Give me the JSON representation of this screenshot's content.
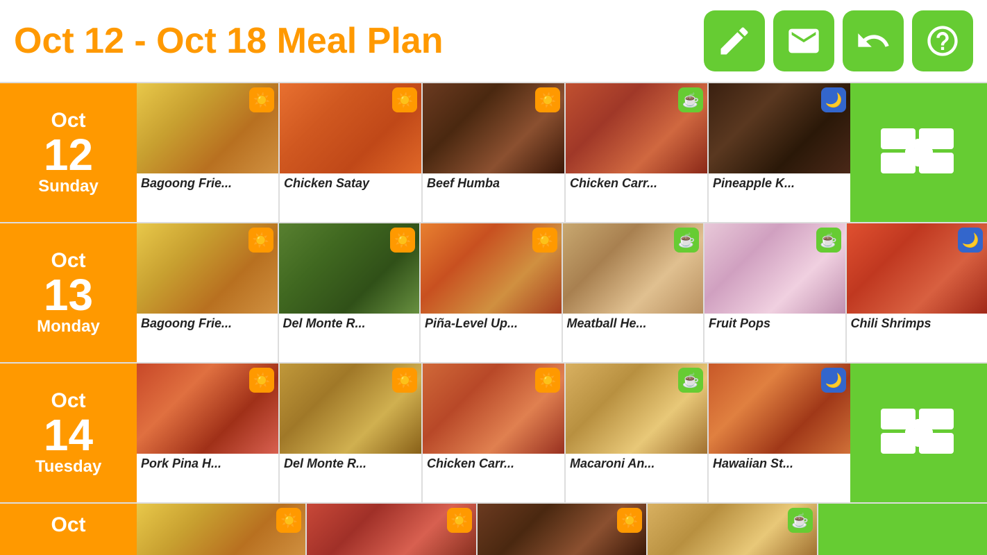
{
  "header": {
    "title": "Oct 12 - Oct 18 Meal Plan",
    "buttons": [
      {
        "name": "edit-button",
        "label": "Edit",
        "icon": "pencil"
      },
      {
        "name": "mail-button",
        "label": "Mail",
        "icon": "mail"
      },
      {
        "name": "undo-button",
        "label": "Undo",
        "icon": "undo"
      },
      {
        "name": "help-button",
        "label": "Help",
        "icon": "question"
      }
    ]
  },
  "days": [
    {
      "month": "Oct",
      "day": "12",
      "dayName": "Sunday",
      "meals": [
        {
          "name": "Bagoong Frie...",
          "type": "breakfast",
          "colorClass": "food-yellow"
        },
        {
          "name": "Chicken Satay",
          "type": "breakfast",
          "colorClass": "food-orange"
        },
        {
          "name": "Beef Humba",
          "type": "breakfast",
          "colorClass": "food-brown"
        },
        {
          "name": "Chicken Carr...",
          "type": "snack",
          "colorClass": "food-red-brown"
        },
        {
          "name": "Pineapple K...",
          "type": "dinner",
          "colorClass": "food-dark"
        }
      ],
      "hasAddButton": true
    },
    {
      "month": "Oct",
      "day": "13",
      "dayName": "Monday",
      "meals": [
        {
          "name": "Bagoong Frie...",
          "type": "breakfast",
          "colorClass": "food-yellow"
        },
        {
          "name": "Del Monte R...",
          "type": "breakfast",
          "colorClass": "food-green"
        },
        {
          "name": "Piña-Level Up...",
          "type": "breakfast",
          "colorClass": "food-colorful"
        },
        {
          "name": "Meatball He...",
          "type": "snack",
          "colorClass": "food-tan"
        },
        {
          "name": "Fruit Pops",
          "type": "snack",
          "colorClass": "food-pastel"
        },
        {
          "name": "Chili Shrimps",
          "type": "dinner",
          "colorClass": "food-shrimp"
        }
      ],
      "hasAddButton": false
    },
    {
      "month": "Oct",
      "day": "14",
      "dayName": "Tuesday",
      "meals": [
        {
          "name": "Pork Pina H...",
          "type": "breakfast",
          "colorClass": "food-pizza"
        },
        {
          "name": "Del Monte R...",
          "type": "breakfast",
          "colorClass": "food-fish"
        },
        {
          "name": "Chicken Carr...",
          "type": "breakfast",
          "colorClass": "food-pasta-red"
        },
        {
          "name": "Macaroni An...",
          "type": "snack",
          "colorClass": "food-macaroni"
        },
        {
          "name": "Hawaiian St...",
          "type": "dinner",
          "colorClass": "food-hawaiian"
        }
      ],
      "hasAddButton": true
    },
    {
      "month": "Oct",
      "day": "",
      "dayName": "",
      "meals": [
        {
          "name": "",
          "type": "breakfast",
          "colorClass": "food-yellow"
        },
        {
          "name": "",
          "type": "breakfast",
          "colorClass": "food-red-mixed"
        },
        {
          "name": "",
          "type": "breakfast",
          "colorClass": "food-brown"
        },
        {
          "name": "",
          "type": "snack",
          "colorClass": "food-macaroni"
        }
      ],
      "hasAddButton": false,
      "partial": true
    }
  ]
}
